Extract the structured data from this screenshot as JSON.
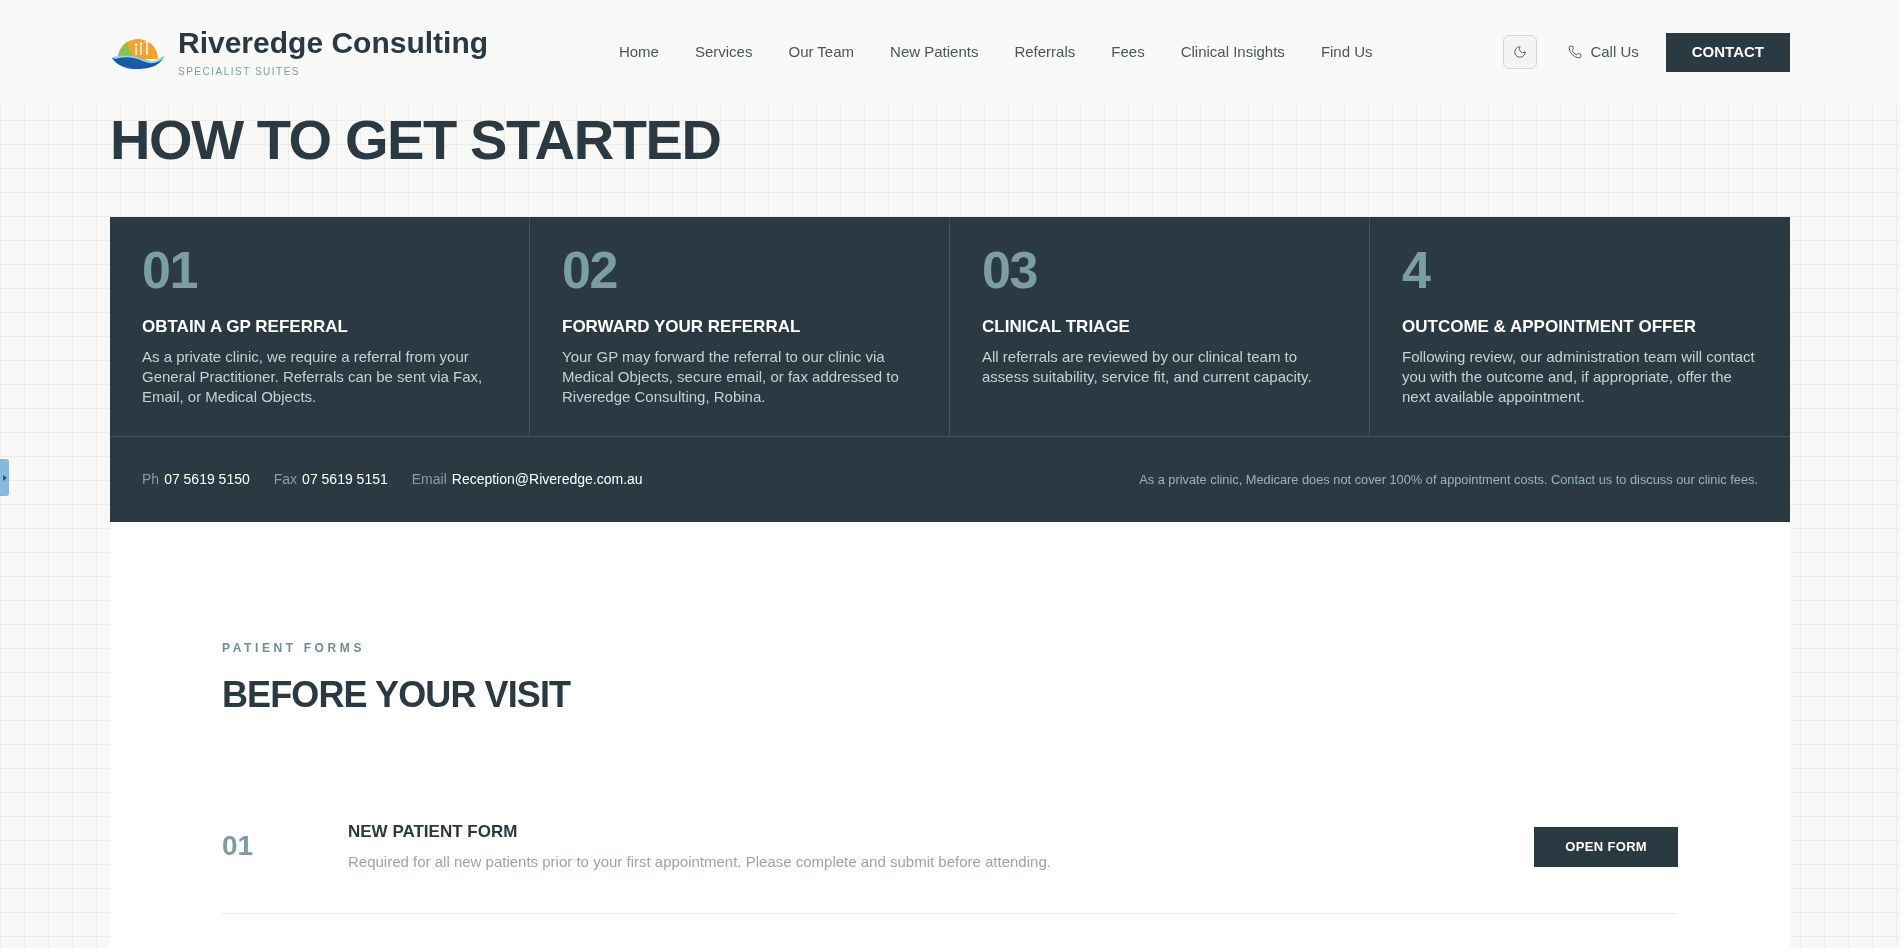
{
  "header": {
    "logo": {
      "name": "Riveredge Consulting",
      "tagline": "SPECIALIST SUITES"
    },
    "nav": [
      {
        "label": "Home"
      },
      {
        "label": "Services"
      },
      {
        "label": "Our Team"
      },
      {
        "label": "New Patients"
      },
      {
        "label": "Referrals"
      },
      {
        "label": "Fees"
      },
      {
        "label": "Clinical Insights"
      },
      {
        "label": "Find Us"
      }
    ],
    "call_link": {
      "label": "Call Us"
    },
    "contact_button": {
      "label": "CONTACT"
    }
  },
  "hero": {
    "title": "HOW TO GET STARTED"
  },
  "steps": [
    {
      "number": "01",
      "title": "OBTAIN A GP REFERRAL",
      "body": "As a private clinic, we require a referral from your General Practitioner. Referrals can be sent via Fax, Email, or Medical Objects."
    },
    {
      "number": "02",
      "title": "FORWARD YOUR REFERRAL",
      "body": "Your GP may forward the referral to our clinic via Medical Objects, secure email, or fax addressed to Riveredge Consulting, Robina."
    },
    {
      "number": "03",
      "title": "CLINICAL TRIAGE",
      "body": "All referrals are reviewed by our clinical team to assess suitability, service fit, and current capacity."
    },
    {
      "number": "4",
      "title": "OUTCOME & APPOINTMENT OFFER",
      "body": "Following review, our administration team will contact you with the outcome and, if appropriate, offer the next available appointment."
    }
  ],
  "contact_bar": {
    "details": [
      {
        "label": "Ph",
        "value": "07 5619 5150"
      },
      {
        "label": "Fax",
        "value": "07 5619 5151"
      },
      {
        "label": "Email",
        "value": "Reception@Riveredge.com.au"
      }
    ],
    "note": {
      "text_before": "As a private clinic, Medicare does not cover 100% of appointment costs.",
      "link": "Contact us",
      "text_after": "to discuss our clinic fees."
    }
  },
  "patient_forms": {
    "eyebrow": "PATIENT FORMS",
    "title": "BEFORE YOUR VISIT",
    "forms": [
      {
        "number": "01",
        "title": "NEW PATIENT FORM",
        "description": "Required for all new patients prior to your first appointment. Please complete and submit before attending.",
        "button": "OPEN FORM"
      }
    ]
  }
}
